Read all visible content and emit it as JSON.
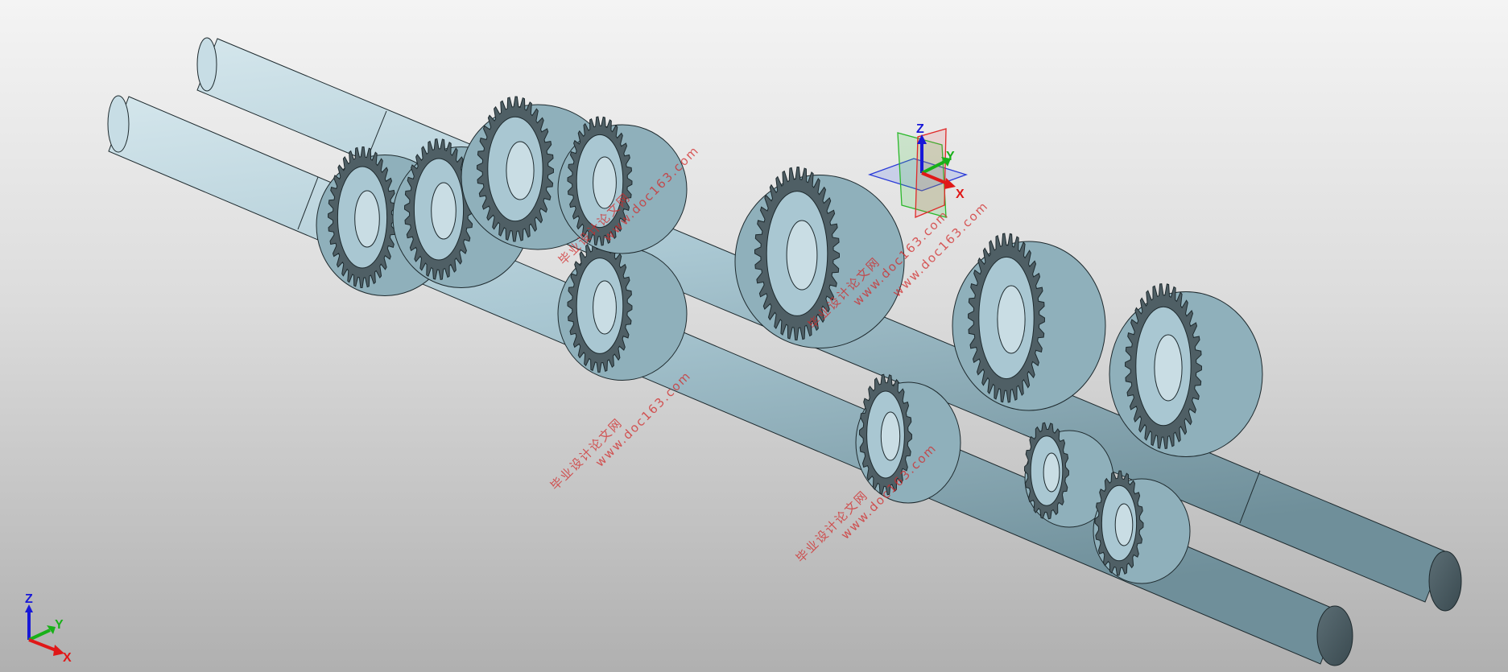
{
  "viewport": {
    "background_top": "#f4f4f4",
    "background_bottom": "#b0b0b0",
    "model_color": "#a9c7d2",
    "model_shadow": "#4a5a60",
    "edge_color": "#1e2a2e"
  },
  "triad_corner": {
    "x_label": "X",
    "y_label": "Y",
    "z_label": "Z",
    "x_color": "#e01818",
    "y_color": "#18b018",
    "z_color": "#1818d8"
  },
  "triad_model": {
    "x_label": "X",
    "y_label": "Y",
    "z_label": "Z"
  },
  "watermarks": [
    {
      "cn": "毕业设计论文网",
      "url": "www.doc163.com"
    },
    {
      "cn": "毕业设计论文网",
      "url": "www.doc163.com"
    },
    {
      "cn": "毕业设计论文网",
      "url": "www.doc163.com"
    },
    {
      "cn": "毕业设计论文网",
      "url": "www.doc163.com"
    },
    {
      "cn": "毕业设计论文网",
      "url": "www.doc163.com"
    }
  ],
  "status": {
    "text": ""
  }
}
